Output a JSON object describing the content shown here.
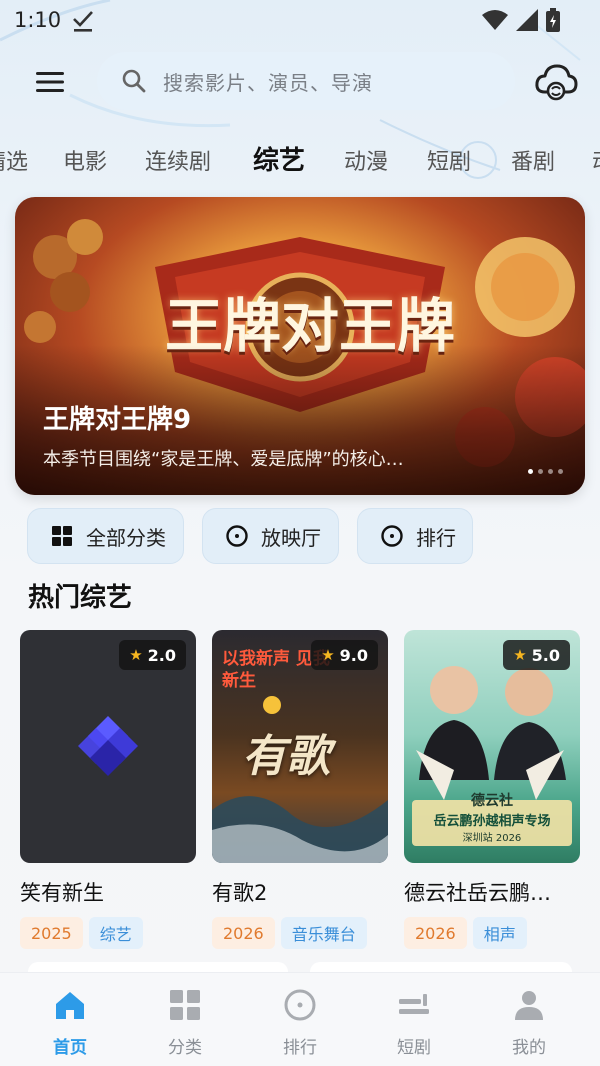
{
  "status_bar": {
    "time": "1:10"
  },
  "header": {
    "search_placeholder": "搜索影片、演员、导演"
  },
  "tabs": [
    "精选",
    "电影",
    "连续剧",
    "综艺",
    "动漫",
    "短剧",
    "番剧",
    "动"
  ],
  "active_tab": "综艺",
  "banner": {
    "title": "王牌对王牌9",
    "description": "本季节目围绕“家是王牌、爱是底牌”的核心…",
    "logo_text": "王牌对王牌",
    "page_count": 4,
    "active_page": 1
  },
  "quick_actions": [
    {
      "label": "全部分类",
      "icon": "grid-icon"
    },
    {
      "label": "放映厅",
      "icon": "circle-play-icon"
    },
    {
      "label": "排行",
      "icon": "circle-rank-icon"
    }
  ],
  "section": {
    "title": "热门综艺"
  },
  "cards": [
    {
      "title": "笑有新生",
      "rating": "2.0",
      "year": "2025",
      "genre": "综艺"
    },
    {
      "title": "有歌2",
      "rating": "9.0",
      "year": "2026",
      "genre": "音乐舞台",
      "poster_text_top": "以我新声 见我新生",
      "poster_logo": "有歌"
    },
    {
      "title": "德云社岳云鹏…",
      "rating": "5.0",
      "year": "2026",
      "genre": "相声",
      "poster_text_1": "德云社",
      "poster_text_2": "岳云鹏孙越相声专场",
      "poster_text_3": "深圳站 2026"
    }
  ],
  "bottom_nav": [
    {
      "label": "首页",
      "icon": "home-icon",
      "active": true
    },
    {
      "label": "分类",
      "icon": "category-icon",
      "active": false
    },
    {
      "label": "排行",
      "icon": "rank-icon",
      "active": false
    },
    {
      "label": "短剧",
      "icon": "short-drama-icon",
      "active": false
    },
    {
      "label": "我的",
      "icon": "profile-icon",
      "active": false
    }
  ],
  "colors": {
    "accent": "#2d9be8",
    "year_tag": "#e07a2e",
    "genre_tag": "#3a8ed8",
    "rating_star": "#f6b620"
  }
}
